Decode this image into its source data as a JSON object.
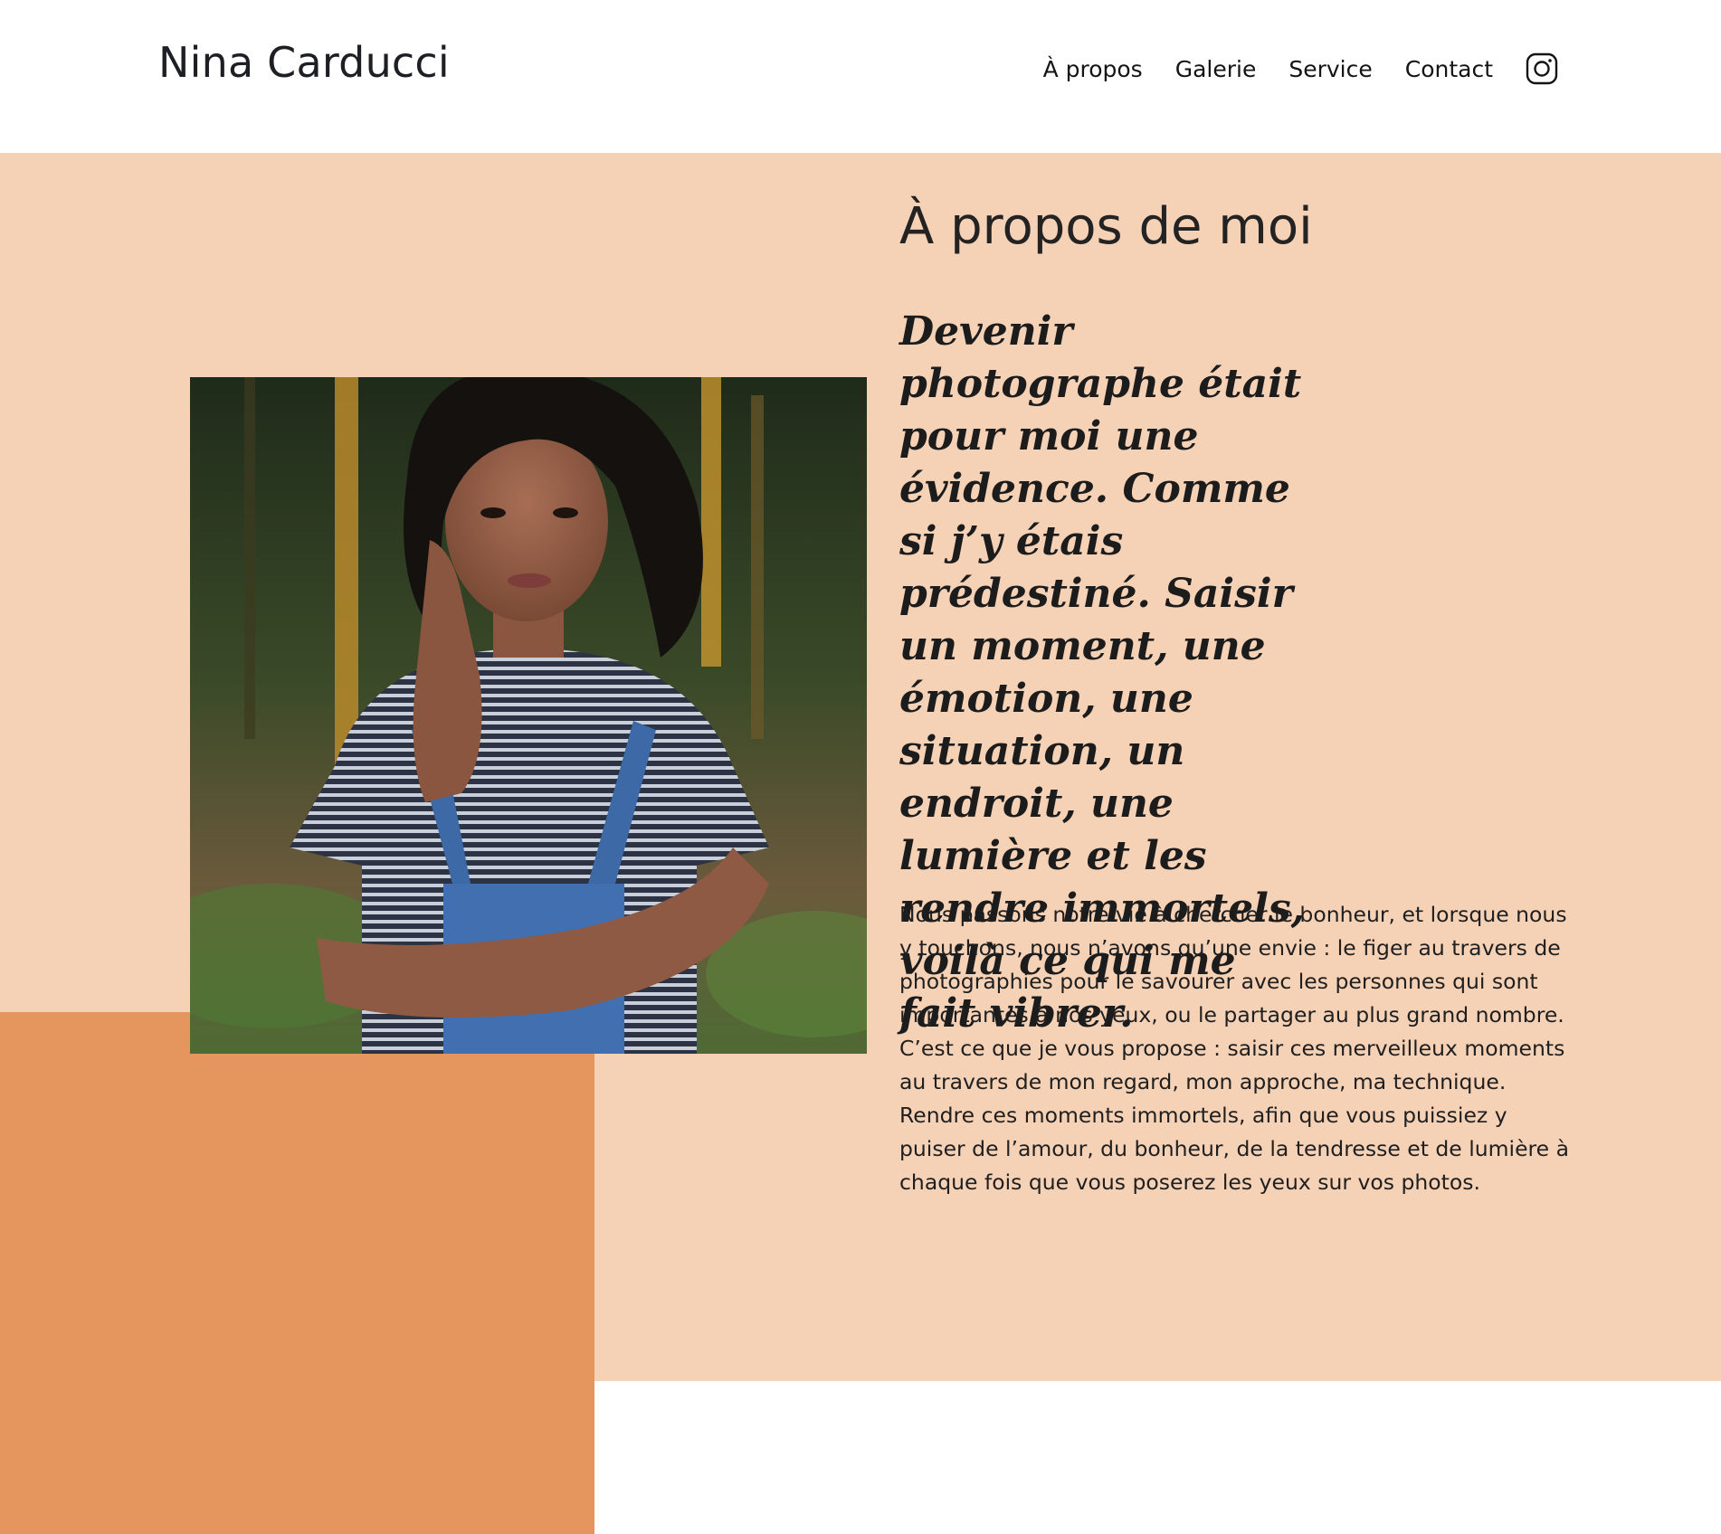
{
  "header": {
    "site_title": "Nina Carducci",
    "nav": [
      {
        "label": "À propos"
      },
      {
        "label": "Galerie"
      },
      {
        "label": "Service"
      },
      {
        "label": "Contact"
      }
    ],
    "social_icon": "instagram-icon"
  },
  "about": {
    "title": "À propos de moi",
    "quote": "Devenir photographe était pour moi une évidence. Comme si j’y étais prédestiné. Saisir un moment, une émotion, une situation, un endroit, une lumière et les rendre immortels, voilà ce qui me fait vibrer.",
    "body": "Nous passons notre vie à chercher le bonheur, et lorsque nous y touchons, nous n’avons qu’une envie : le figer au travers de photographies pour le savourer avec les personnes qui sont importantes à nos yeux, ou le partager au plus grand nombre. C’est ce que je vous propose : saisir ces merveilleux moments au travers de mon regard, mon approche, ma technique. Rendre ces moments immortels, afin que vous puissiez y puiser de l’amour, du bonheur, de la tendresse et de lumière à chaque fois que vous poserez les yeux sur vos photos."
  },
  "colors": {
    "section_bg": "#f5d1b6",
    "accent_block": "#e5955e",
    "text": "#1f1f1f",
    "header_bg": "#ffffff"
  }
}
